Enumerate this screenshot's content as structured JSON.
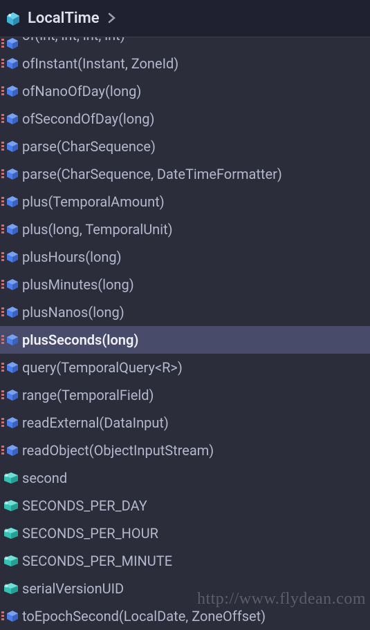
{
  "header": {
    "class_name": "LocalTime"
  },
  "items": [
    {
      "label": "of(int, int, int, int)",
      "type": "method",
      "selected": false,
      "partial": true
    },
    {
      "label": "ofInstant(Instant, ZoneId)",
      "type": "method",
      "selected": false
    },
    {
      "label": "ofNanoOfDay(long)",
      "type": "method",
      "selected": false
    },
    {
      "label": "ofSecondOfDay(long)",
      "type": "method",
      "selected": false
    },
    {
      "label": "parse(CharSequence)",
      "type": "method",
      "selected": false
    },
    {
      "label": "parse(CharSequence, DateTimeFormatter)",
      "type": "method",
      "selected": false
    },
    {
      "label": "plus(TemporalAmount)",
      "type": "method",
      "selected": false
    },
    {
      "label": "plus(long, TemporalUnit)",
      "type": "method",
      "selected": false
    },
    {
      "label": "plusHours(long)",
      "type": "method",
      "selected": false
    },
    {
      "label": "plusMinutes(long)",
      "type": "method",
      "selected": false
    },
    {
      "label": "plusNanos(long)",
      "type": "method",
      "selected": false
    },
    {
      "label": "plusSeconds(long)",
      "type": "method",
      "selected": true
    },
    {
      "label": "query(TemporalQuery<R>)",
      "type": "method",
      "selected": false
    },
    {
      "label": "range(TemporalField)",
      "type": "method",
      "selected": false
    },
    {
      "label": "readExternal(DataInput)",
      "type": "method",
      "selected": false
    },
    {
      "label": "readObject(ObjectInputStream)",
      "type": "method",
      "selected": false
    },
    {
      "label": "second",
      "type": "field",
      "selected": false
    },
    {
      "label": "SECONDS_PER_DAY",
      "type": "field",
      "selected": false
    },
    {
      "label": "SECONDS_PER_HOUR",
      "type": "field",
      "selected": false
    },
    {
      "label": "SECONDS_PER_MINUTE",
      "type": "field",
      "selected": false
    },
    {
      "label": "serialVersionUID",
      "type": "field",
      "selected": false
    },
    {
      "label": "toEpochSecond(LocalDate, ZoneOffset)",
      "type": "method",
      "selected": false,
      "partial": true
    }
  ],
  "watermark": "http://www.flydean.com"
}
